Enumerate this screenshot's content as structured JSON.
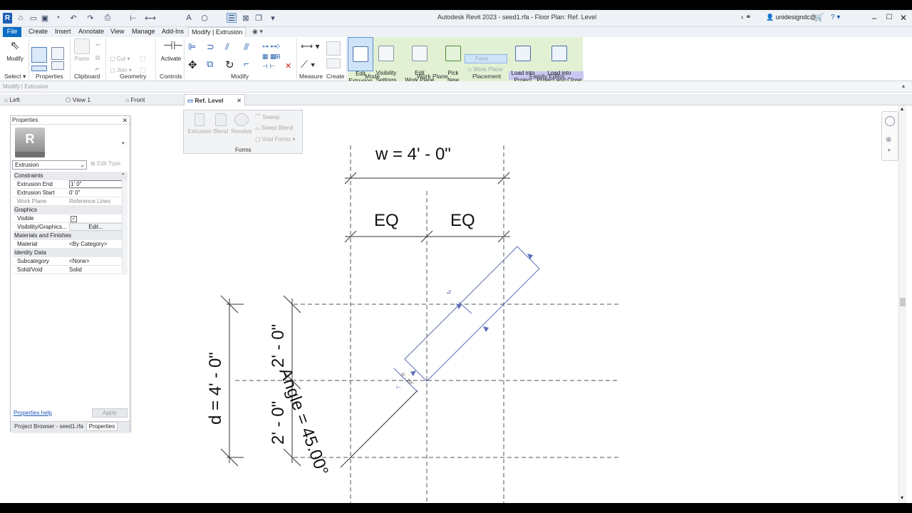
{
  "app": {
    "title": "Autodesk Revit 2023 - seed1.rfa - Floor Plan: Ref. Level",
    "user": "unidesigndc@...",
    "app_letter": "R"
  },
  "ribbon_tabs": [
    "File",
    "Create",
    "Insert",
    "Annotate",
    "View",
    "Manage",
    "Add-Ins",
    "Modify | Extrusion"
  ],
  "ribbon": {
    "select": {
      "modify_label": "Modify",
      "group": "Select ▾"
    },
    "properties_group": "Properties",
    "clipboard": {
      "paste": "Paste",
      "cut": "Cut",
      "join": "Join",
      "group": "Clipboard"
    },
    "geometry_group": "Geometry",
    "controls": {
      "activate": "Activate",
      "group": "Controls"
    },
    "modify_group": "Modify",
    "measure_group": "Measure",
    "create_group": "Create",
    "mode": {
      "edit_extrusion": "Edit\nExtrusion",
      "group": "Mode"
    },
    "visibility_settings": "Visibility\nSettings",
    "work_plane": {
      "edit": "Edit\nWork Plane",
      "pick_new": "Pick\nNew",
      "group": "Work Plane"
    },
    "placement": {
      "face": "Face",
      "work_plane": "Work Plane",
      "group": "Placement"
    },
    "family_editor": {
      "load_into_project": "Load into\nProject",
      "load_and_close": "Load into\nProject and Close",
      "group": "Family Editor"
    }
  },
  "options_bar": "Modify | Extrusion",
  "view_tabs": [
    {
      "label": "Left"
    },
    {
      "label": "View 1"
    },
    {
      "label": "Front"
    },
    {
      "label": "Ref. Level"
    }
  ],
  "forms_panel": {
    "extrusion": "Extrusion",
    "blend": "Blend",
    "revolve": "Revolve",
    "sweep": "Sweep",
    "swept_blend": "Swept  Blend",
    "void_forms": "Void  Forms",
    "title": "Forms"
  },
  "properties": {
    "title": "Properties",
    "type_selector": "Extrusion",
    "edit_type": "Edit Type",
    "sections": {
      "constraints": "Constraints",
      "graphics": "Graphics",
      "materials": "Materials and Finishes",
      "identity": "Identity Data"
    },
    "rows": {
      "extrusion_end": {
        "key": "Extrusion End",
        "value": "1'  0\""
      },
      "extrusion_start": {
        "key": "Extrusion Start",
        "value": "0'  0\""
      },
      "work_plane": {
        "key": "Work Plane",
        "value": "Reference Lines"
      },
      "visible": {
        "key": "Visible",
        "value": "✓"
      },
      "visibility_graphics": {
        "key": "Visibility/Graphics...",
        "value": "Edit..."
      },
      "material": {
        "key": "Material",
        "value": "<By Category>"
      },
      "subcategory": {
        "key": "Subcategory",
        "value": "<None>"
      },
      "solid_void": {
        "key": "Solid/Void",
        "value": "Solid"
      }
    },
    "help": "Properties help",
    "apply": "Apply",
    "tab_browser": "Project Browser - seed1.rfa",
    "tab_properties": "Properties"
  },
  "drawing": {
    "width_dim": "w = 4' - 0\"",
    "eq_left": "EQ",
    "eq_right": "EQ",
    "depth_dim": "d = 4' - 0\"",
    "half_top": "2' - 0\"",
    "half_bottom": "2' - 0\"",
    "angle": "Angle = 45.00°",
    "small_dim": "0' - 10\""
  }
}
